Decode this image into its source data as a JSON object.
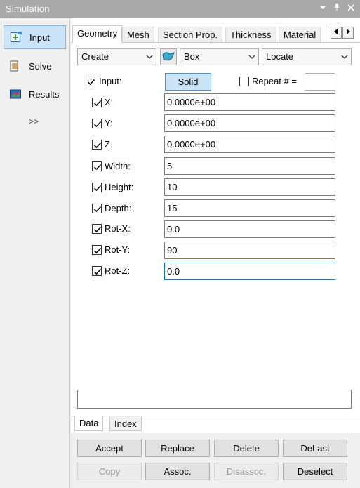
{
  "window": {
    "title": "Simulation"
  },
  "nav": {
    "items": [
      {
        "label": "Input"
      },
      {
        "label": "Solve"
      },
      {
        "label": "Results"
      }
    ],
    "more_label": ">>"
  },
  "tabs": [
    "Geometry",
    "Mesh",
    "Section Prop.",
    "Thickness",
    "Material"
  ],
  "toolbar": {
    "action_value": "Create",
    "shape_value": "Box",
    "locate_value": "Locate"
  },
  "input_row": {
    "input_label": "Input:",
    "solid_label": "Solid",
    "repeat_label": "Repeat # =",
    "repeat_value": ""
  },
  "params": [
    {
      "label": "X:",
      "value": "0.0000e+00"
    },
    {
      "label": "Y:",
      "value": "0.0000e+00"
    },
    {
      "label": "Z:",
      "value": "0.0000e+00"
    },
    {
      "label": "Width:",
      "value": "5"
    },
    {
      "label": "Height:",
      "value": "10"
    },
    {
      "label": "Depth:",
      "value": "15"
    },
    {
      "label": "Rot-X:",
      "value": "0.0"
    },
    {
      "label": "Rot-Y:",
      "value": "90"
    },
    {
      "label": "Rot-Z:",
      "value": "0.0"
    }
  ],
  "message": "",
  "bottom_tabs": [
    "Data",
    "Index"
  ],
  "buttons": {
    "accept": "Accept",
    "replace": "Replace",
    "delete": "Delete",
    "delast": "DeLast",
    "copy": "Copy",
    "assoc": "Assoc.",
    "disassoc": "Disassoc.",
    "deselect": "Deselect"
  },
  "colors": {
    "accent": "#0078d7",
    "active_bg": "#cce4f7",
    "title_bar": "#a9a9a9"
  }
}
